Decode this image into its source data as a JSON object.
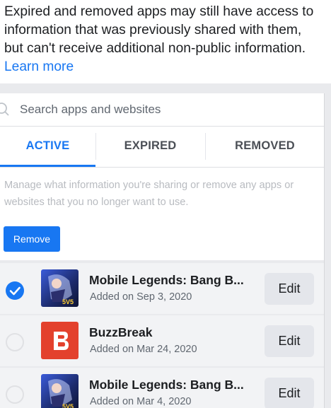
{
  "intro": {
    "text": "Expired and removed apps may still have access to information that was previously shared with them, but can't receive additional non-public information.",
    "learn_more": "Learn more"
  },
  "search": {
    "placeholder": "Search apps and websites",
    "icon": "search-icon"
  },
  "tabs": [
    {
      "label": "ACTIVE",
      "active": true
    },
    {
      "label": "EXPIRED",
      "active": false
    },
    {
      "label": "REMOVED",
      "active": false
    }
  ],
  "description": "Manage what information you're sharing or remove any apps or websites that you no longer want to use.",
  "remove_button": "Remove",
  "apps": [
    {
      "name": "Mobile Legends: Bang B...",
      "added": "Added on Sep 3, 2020",
      "selected": true,
      "icon": "mobile-legends-icon",
      "edit": "Edit"
    },
    {
      "name": "BuzzBreak",
      "added": "Added on Mar 24, 2020",
      "selected": false,
      "icon": "buzzbreak-icon",
      "edit": "Edit"
    },
    {
      "name": "Mobile Legends: Bang B...",
      "added": "Added on Mar 4, 2020",
      "selected": false,
      "icon": "mobile-legends-icon",
      "edit": "Edit"
    }
  ],
  "colors": {
    "accent": "#1877f2",
    "buzzbreak": "#e3412d",
    "row_bg": "#f2f3f5"
  }
}
